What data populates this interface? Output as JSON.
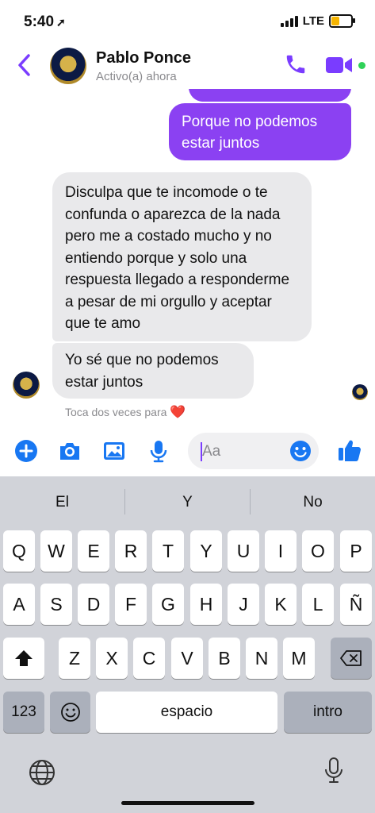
{
  "status": {
    "time": "5:40",
    "network": "LTE"
  },
  "header": {
    "back_icon": "chevron-left-icon",
    "name": "Pablo Ponce",
    "status": "Activo(a) ahora",
    "accent": "#7a3cff"
  },
  "messages": {
    "outgoing": "Porque no podemos estar juntos",
    "incoming1": "Disculpa que te incomode o te confunda o aparezca de la nada pero me a costado mucho y no entiendo porque y solo una respuesta llegado a responderme a pesar de mi orgullo y aceptar que te amo",
    "incoming2": "Yo sé que no podemos estar juntos",
    "hint": "Toca dos veces para",
    "hint_heart": "❤️"
  },
  "composer": {
    "placeholder": "Aa"
  },
  "keyboard": {
    "suggestions": [
      "El",
      "Y",
      "No"
    ],
    "row1": [
      "Q",
      "W",
      "E",
      "R",
      "T",
      "Y",
      "U",
      "I",
      "O",
      "P"
    ],
    "row2": [
      "A",
      "S",
      "D",
      "F",
      "G",
      "H",
      "J",
      "K",
      "L",
      "Ñ"
    ],
    "row3": [
      "Z",
      "X",
      "C",
      "V",
      "B",
      "N",
      "M"
    ],
    "numbers": "123",
    "space": "espacio",
    "return": "intro"
  }
}
